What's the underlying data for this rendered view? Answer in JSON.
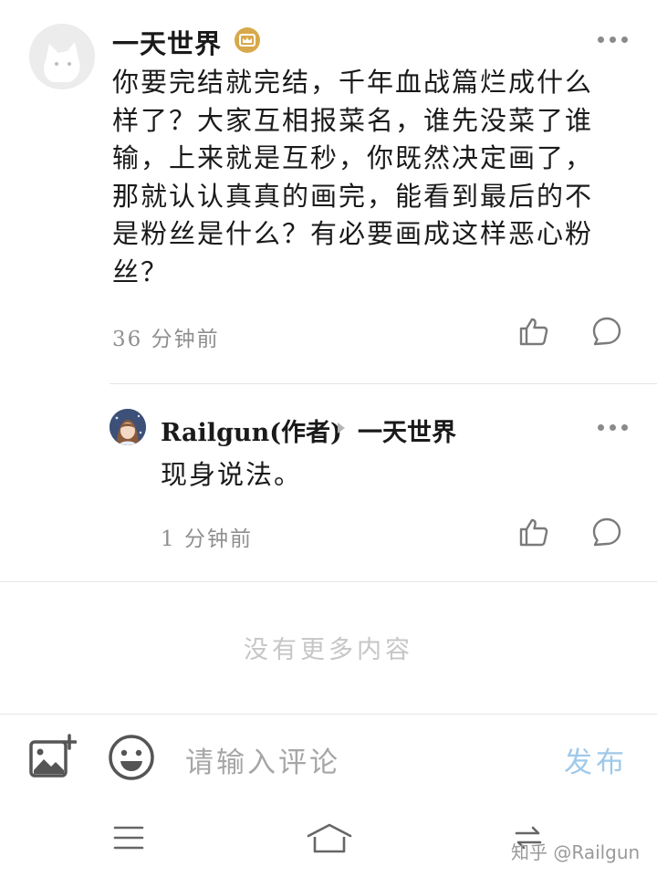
{
  "comment": {
    "author": "一天世界",
    "badge_icon": "crown-badge-icon",
    "lines": [
      "你要完结就完结，千年血战篇烂成什么",
      "样了？大家互相报菜名，谁先没菜了谁",
      "输，上来就是互秒，你既然决定画了，",
      "那就认认真真的画完，能看到最后的不",
      "是粉丝是什么？有必要画成这样恶心粉",
      "丝？"
    ],
    "time": "36 分钟前"
  },
  "reply": {
    "author": "Railgun(作者)",
    "to": "一天世界",
    "text": "现身说法。",
    "time": "1 分钟前"
  },
  "no_more": "没有更多内容",
  "input_bar": {
    "placeholder": "请输入评论",
    "publish": "发布"
  },
  "watermark": "知乎 @Railgun",
  "colors": {
    "badge": "#d8a94a",
    "publish": "#9fc9ea",
    "meta": "#8f8f8f"
  }
}
